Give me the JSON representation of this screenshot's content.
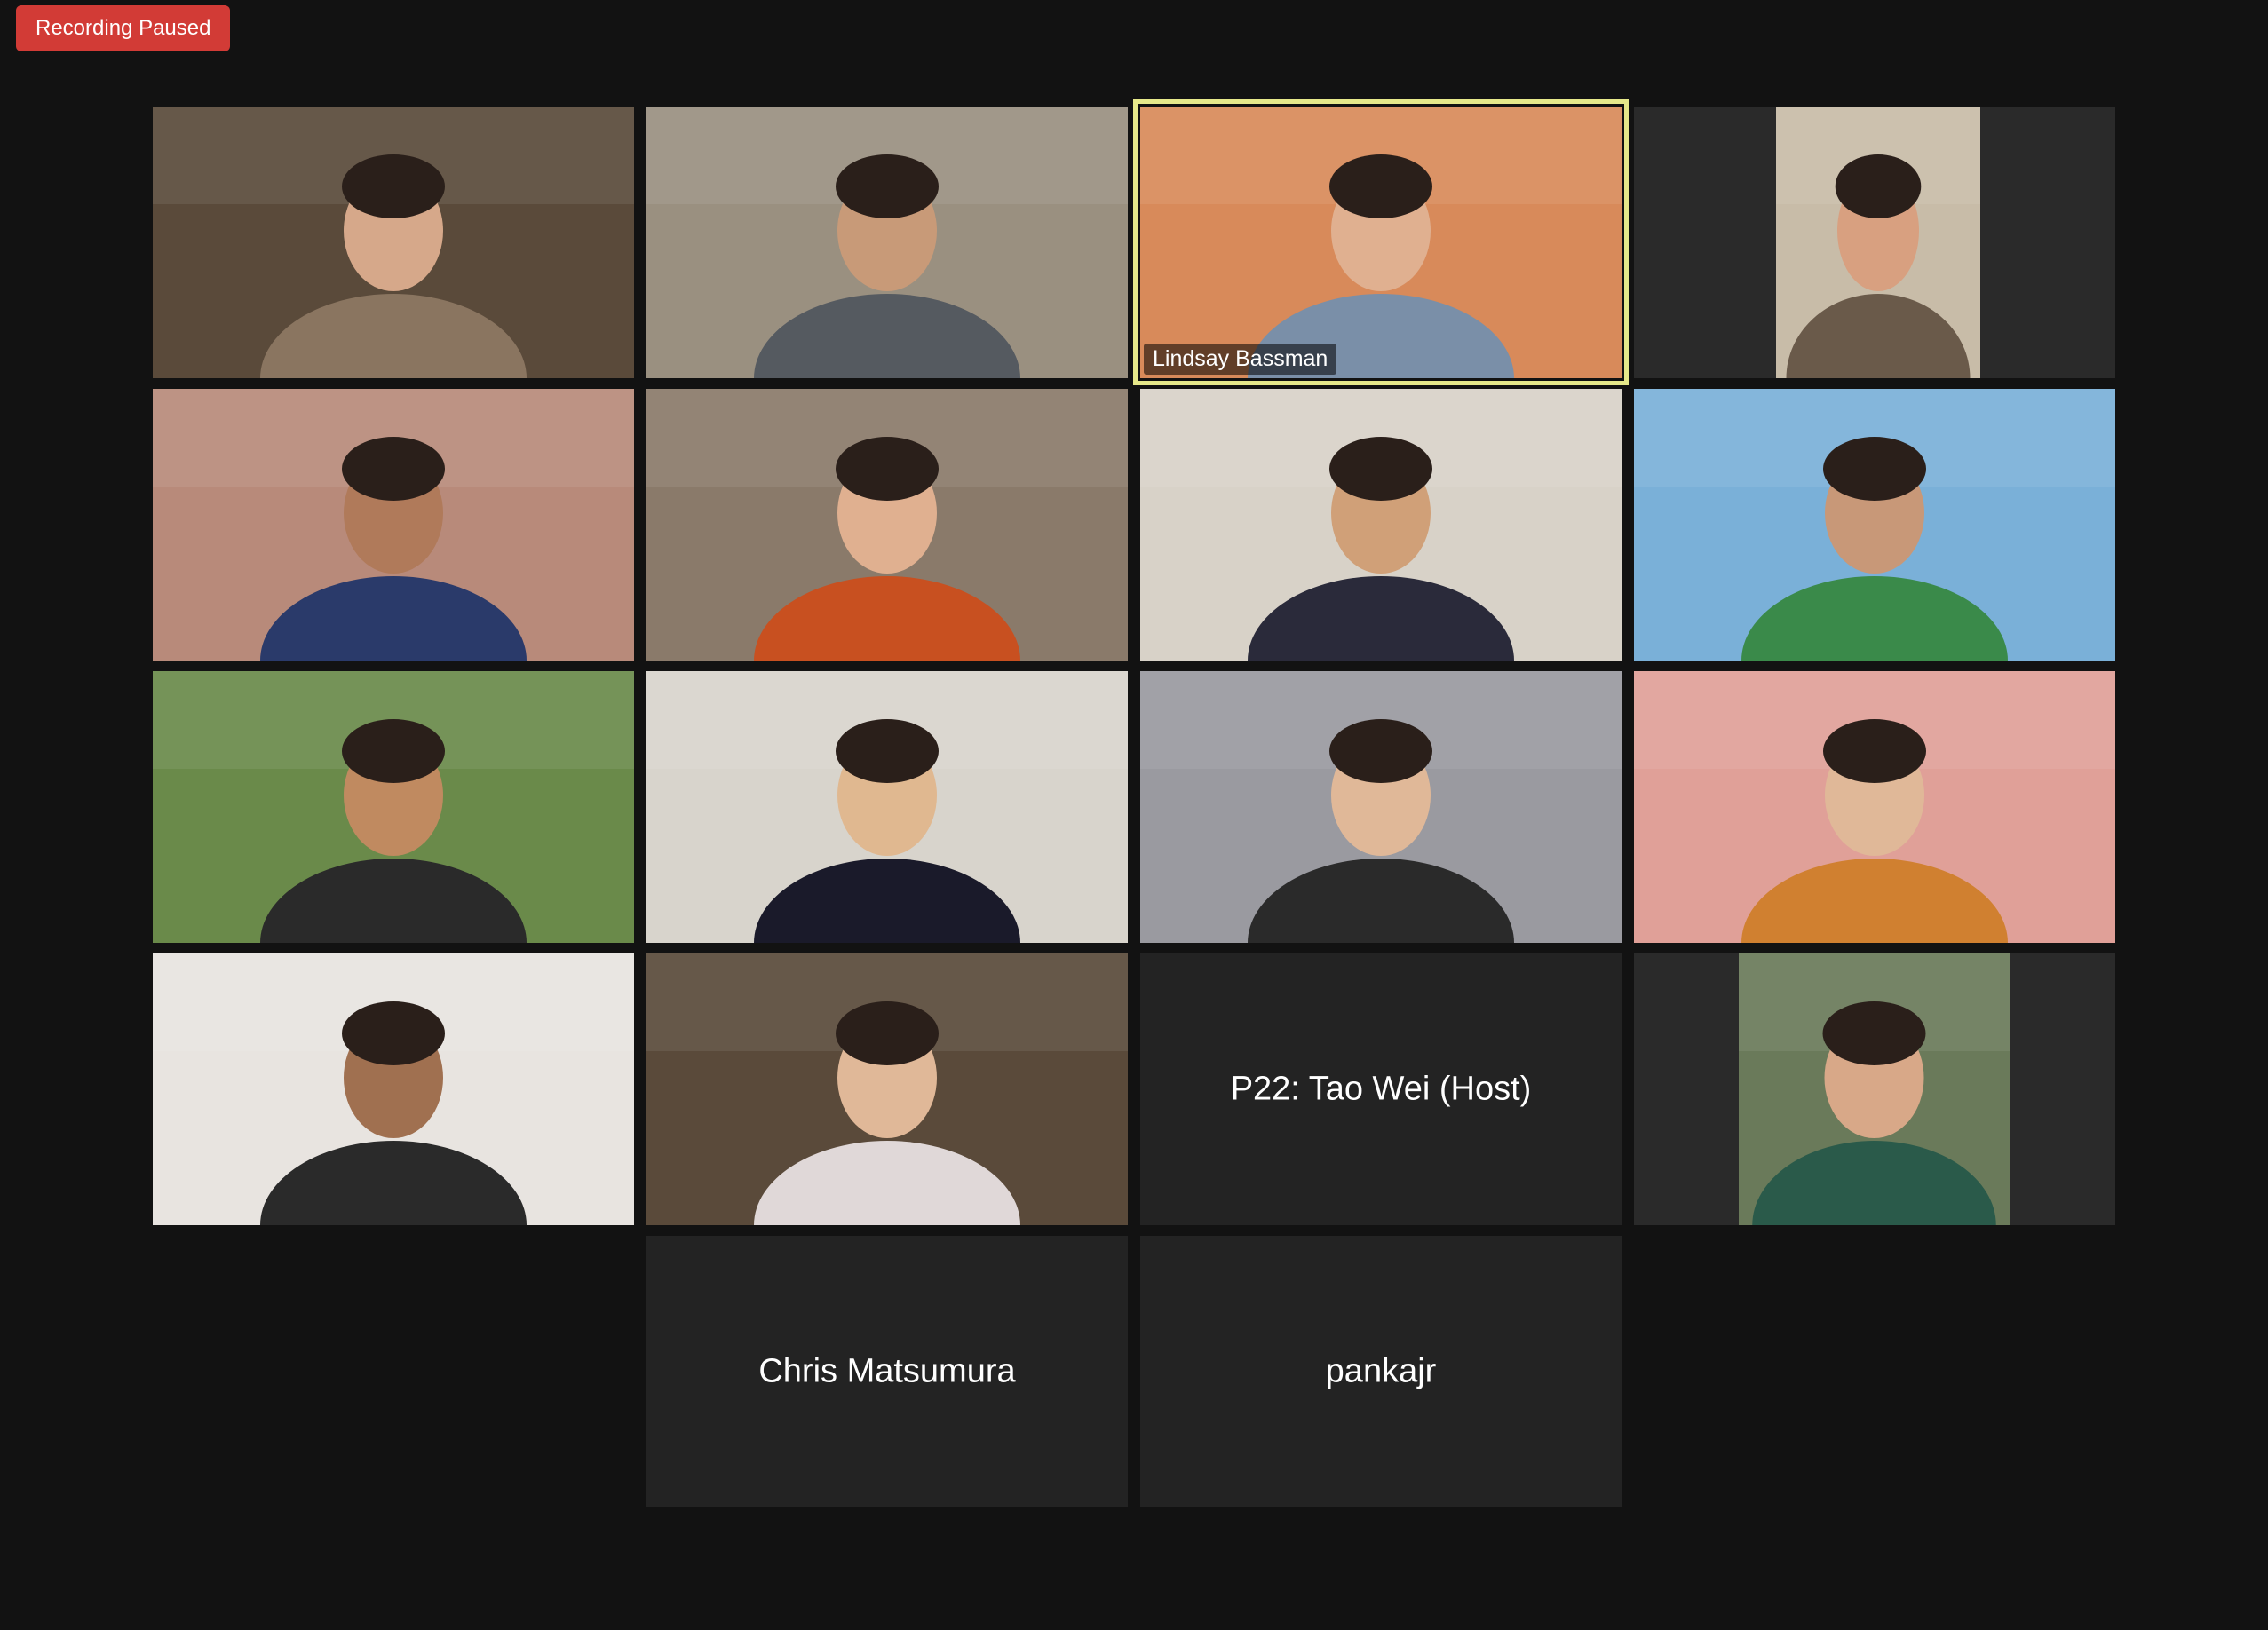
{
  "recording_badge": {
    "label": "Recording Paused",
    "color": "#d23b36"
  },
  "active_speaker_border_color": "#e6e88a",
  "participants": [
    {
      "name": "",
      "video": true
    },
    {
      "name": "",
      "video": true
    },
    {
      "name": "Lindsay Bassman",
      "video": true,
      "active_speaker": true
    },
    {
      "name": "",
      "video": true
    },
    {
      "name": "",
      "video": true
    },
    {
      "name": "",
      "video": true
    },
    {
      "name": "",
      "video": true
    },
    {
      "name": "",
      "video": true
    },
    {
      "name": "",
      "video": true
    },
    {
      "name": "",
      "video": true
    },
    {
      "name": "",
      "video": true
    },
    {
      "name": "",
      "video": true
    },
    {
      "name": "",
      "video": true
    },
    {
      "name": "",
      "video": true
    },
    {
      "name": "P22: Tao Wei (Host)",
      "video": false
    },
    {
      "name": "",
      "video": true
    },
    {
      "name": "Chris Matsumura",
      "video": false
    },
    {
      "name": "pankajr",
      "video": false
    }
  ]
}
